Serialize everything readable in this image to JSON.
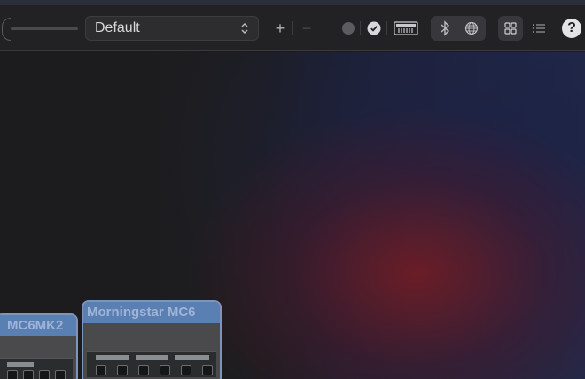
{
  "toolbar": {
    "preset_value": "Default",
    "preset_chevron": "⌃⌄",
    "add_label": "+",
    "remove_label": "−",
    "help_label": "?",
    "icons": [
      "zoom-slider",
      "chevron-updown-icon",
      "plus-icon",
      "minus-icon",
      "info-icon",
      "check-circle-icon",
      "midi-keyboard-icon",
      "bluetooth-icon",
      "network-globe-icon",
      "grid-view-icon",
      "list-view-icon",
      "help-icon"
    ]
  },
  "devices": [
    {
      "name": "MC6MK2"
    },
    {
      "name": "Morningstar MC6"
    }
  ],
  "colors": {
    "device_border": "#7d95bd",
    "device_title_bg": "#5a7fb3",
    "device_title_text": "#9fb4d6"
  }
}
